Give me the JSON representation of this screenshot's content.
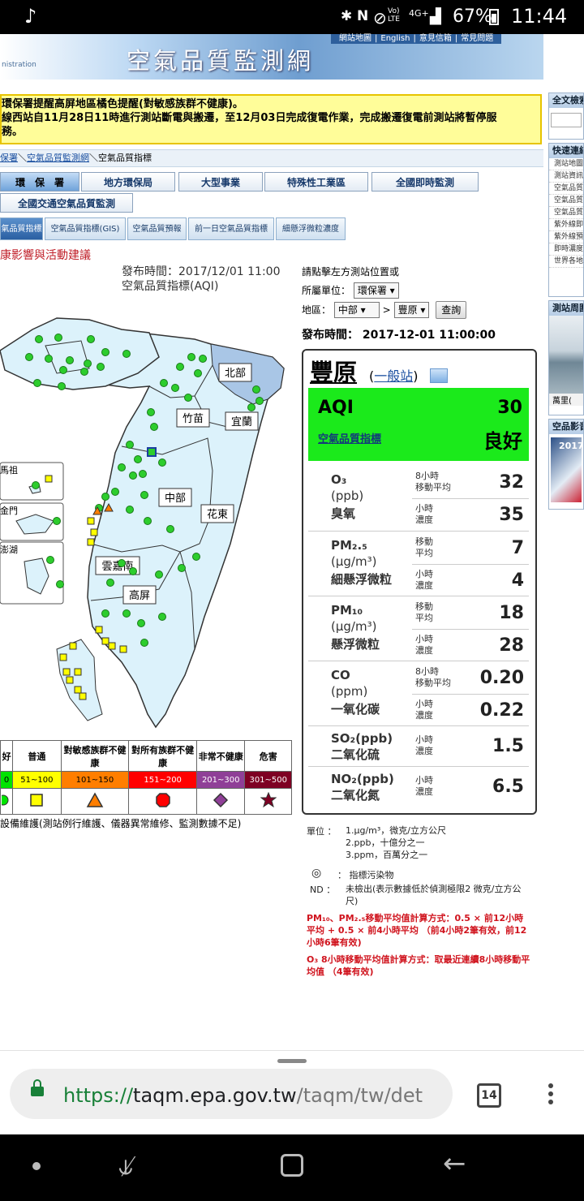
{
  "status_bar": {
    "percent": "67%",
    "time": "11:44",
    "network": "4G+",
    "volte": "Vo) LTE"
  },
  "banner": {
    "title": "空氣品質監測網",
    "brand": "nistration",
    "links": [
      "網站地圖",
      "English",
      "意見信箱",
      "常見問題"
    ]
  },
  "alert": {
    "line1": "環保署提醒高屏地區橘色提醒(對敏感族群不健康)。",
    "line2": "線西站自11月28日11時進行測站斷電與搬遷，至12月03日完成復電作業，完成搬遷復電前測站將暫停服",
    "line3": "務。"
  },
  "breadcrumb": {
    "items": [
      "保署",
      "空氣品質監測網",
      "空氣品質指標"
    ]
  },
  "tabs": {
    "row1": [
      "環　保　署",
      "地方環保局",
      "大型事業",
      "特殊性工業區",
      "全國即時監測"
    ],
    "row2": [
      "全國交通空氣品質監測"
    ],
    "sub": [
      "氣品質指標",
      "空氣品質指標(GIS)",
      "空氣品質預報",
      "前一日空氣品質指標",
      "細懸浮微粒濃度"
    ]
  },
  "section_heading": "康影響與活動建議",
  "map_caption": {
    "publish": "發布時間：2017/12/01 11:00",
    "index": "空氣品質指標(AQI)"
  },
  "map": {
    "regions": [
      "北部",
      "竹苗",
      "宜蘭",
      "中部",
      "花東",
      "雲嘉南",
      "高屏"
    ],
    "insets": [
      "馬祖",
      "金門",
      "澎湖"
    ]
  },
  "legend": {
    "categories": [
      "好",
      "普通",
      "對敏感族群不健康",
      "對所有族群不健康",
      "非常不健康",
      "危害"
    ],
    "ranges": [
      "0",
      "51~100",
      "101~150",
      "151~200",
      "201~300",
      "301~500"
    ],
    "colors": [
      "#00e400",
      "#ffff00",
      "#ff7e00",
      "#ff0000",
      "#8f3f97",
      "#7e0023"
    ],
    "note": "設備維護(測站例行維護、儀器異常維修、監測數據不足)"
  },
  "controls": {
    "hint": "請點擊左方測站位置或",
    "unit_label": "所屬單位：",
    "unit_value": "環保署",
    "area_label": "地區：",
    "area_value": "中部",
    "station_value": "豐原",
    "query_button": "查詢",
    "publish_time": "發布時間： 2017-12-01 11:00:00"
  },
  "station": {
    "name": "豐原",
    "type": "一般站",
    "aqi_label": "AQI",
    "aqi_value": "30",
    "aqi_link": "空氣品質指標",
    "status": "良好",
    "pollutants": [
      {
        "name": "O₃",
        "unit": "(ppb)",
        "zh": "臭氧",
        "r1_label": [
          "8小時",
          "移動平均"
        ],
        "r1_value": "32",
        "r2_label": [
          "小時",
          "濃度"
        ],
        "r2_value": "35"
      },
      {
        "name": "PM₂.₅",
        "unit": "(μg/m³)",
        "zh": "細懸浮微粒",
        "r1_label": [
          "移動",
          "平均"
        ],
        "r1_value": "7",
        "r2_label": [
          "小時",
          "濃度"
        ],
        "r2_value": "4"
      },
      {
        "name": "PM₁₀",
        "unit": "(μg/m³)",
        "zh": "懸浮微粒",
        "r1_label": [
          "移動",
          "平均"
        ],
        "r1_value": "18",
        "r2_label": [
          "小時",
          "濃度"
        ],
        "r2_value": "28"
      },
      {
        "name": "CO",
        "unit": "(ppm)",
        "zh": "一氧化碳",
        "r1_label": [
          "8小時",
          "移動平均"
        ],
        "r1_value": "0.20",
        "r2_label": [
          "小時",
          "濃度"
        ],
        "r2_value": "0.22"
      }
    ],
    "so2": {
      "name": "SO₂(ppb)",
      "zh": "二氧化硫",
      "label": [
        "小時",
        "濃度"
      ],
      "value": "1.5"
    },
    "no2": {
      "name": "NO₂(ppb)",
      "zh": "二氧化氮",
      "label": [
        "小時",
        "濃度"
      ],
      "value": "6.5"
    }
  },
  "notes": {
    "unit_label": "單位 ：",
    "units": [
      "1.μg/m³，微克/立方公尺",
      "2.ppb，十億分之一",
      "3.ppm，百萬分之一"
    ],
    "indicator_label": "： 指標污染物",
    "nd_label": "ND ：",
    "nd_text": "未檢出(表示數據低於偵測極限2 微克/立方公尺)",
    "red1": "PM₁₀、PM₂.₅移動平均值計算方式：0.5 × 前12小時平均 + 0.5 × 前4小時平均 （前4小時2筆有效，前12小時6筆有效)",
    "red2": "O₃ 8小時移動平均值計算方式：取最近連續8小時移動平均值 （4筆有效)"
  },
  "side": {
    "box1_title": "全文檢索",
    "box2_title": "快速連結",
    "box2_items": [
      "測站地圖",
      "測站資訊",
      "空氣品質",
      "空氣品質",
      "空氣品質",
      "紫外線即",
      "紫外線預",
      "即時濃度",
      "世界各地"
    ],
    "box3_title": "測站周圍",
    "box3_caption": "萬里(",
    "box4_title": "空品影音",
    "box4_caption": "2017"
  },
  "browser": {
    "url_scheme": "https://",
    "url_host": "taqm.epa.gov.tw",
    "url_path": "/taqm/tw/det",
    "tab_count": "14"
  }
}
